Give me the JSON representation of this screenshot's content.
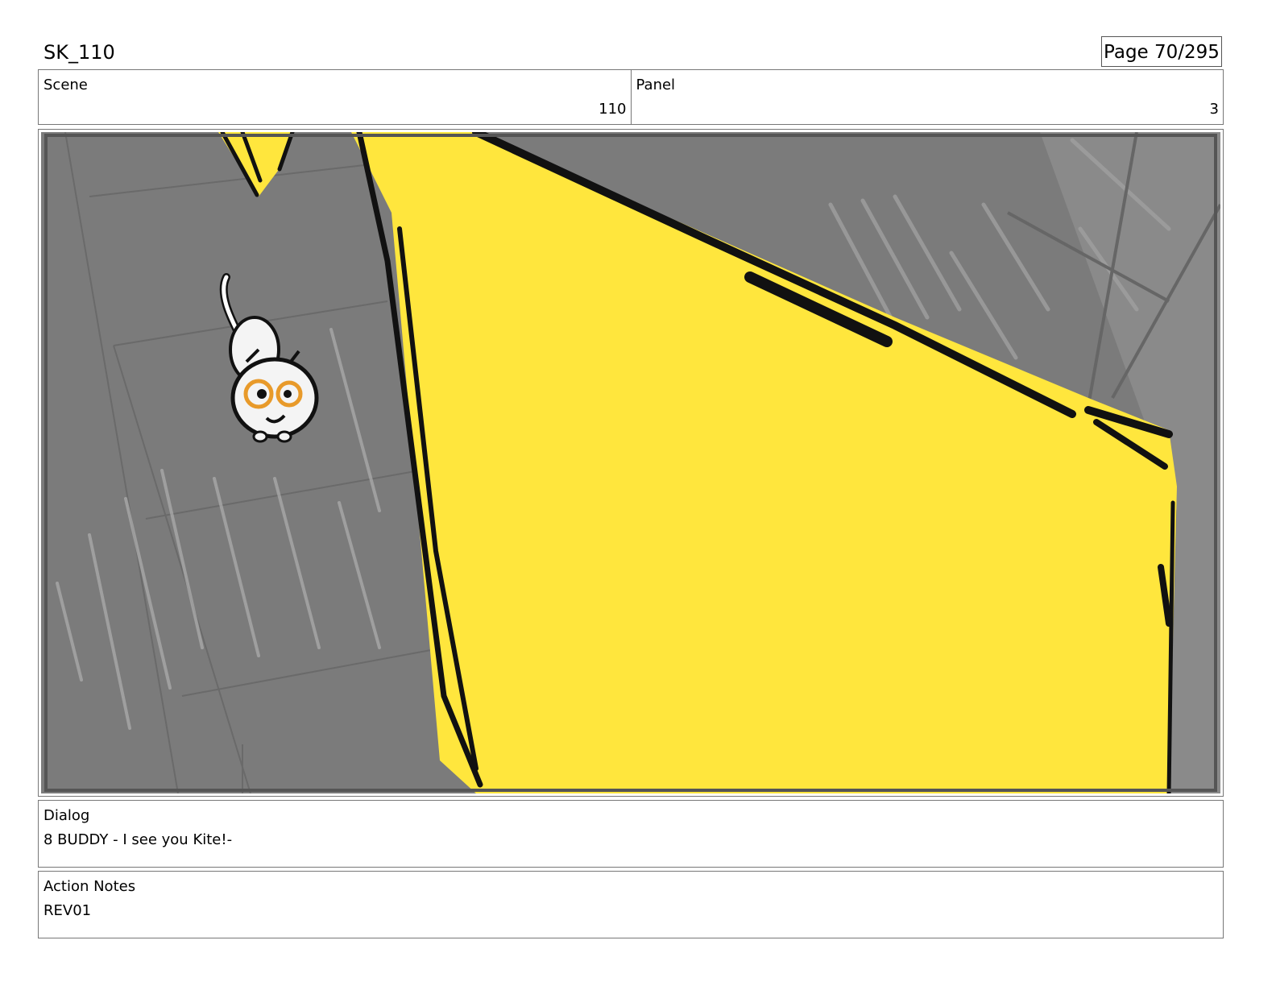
{
  "header": {
    "sequence": "SK_110",
    "page": "Page  70/295"
  },
  "info": {
    "scene_label": "Scene",
    "scene_value": "110",
    "panel_label": "Panel",
    "panel_value": "3"
  },
  "dialog": {
    "label": "Dialog",
    "text": "8 BUDDY - I see you Kite!-"
  },
  "action_notes": {
    "label": "Action Notes",
    "text": "REV01"
  },
  "colors": {
    "yellow": "#ffe63d",
    "floor": "#7a7a7a",
    "ink": "#111111"
  }
}
